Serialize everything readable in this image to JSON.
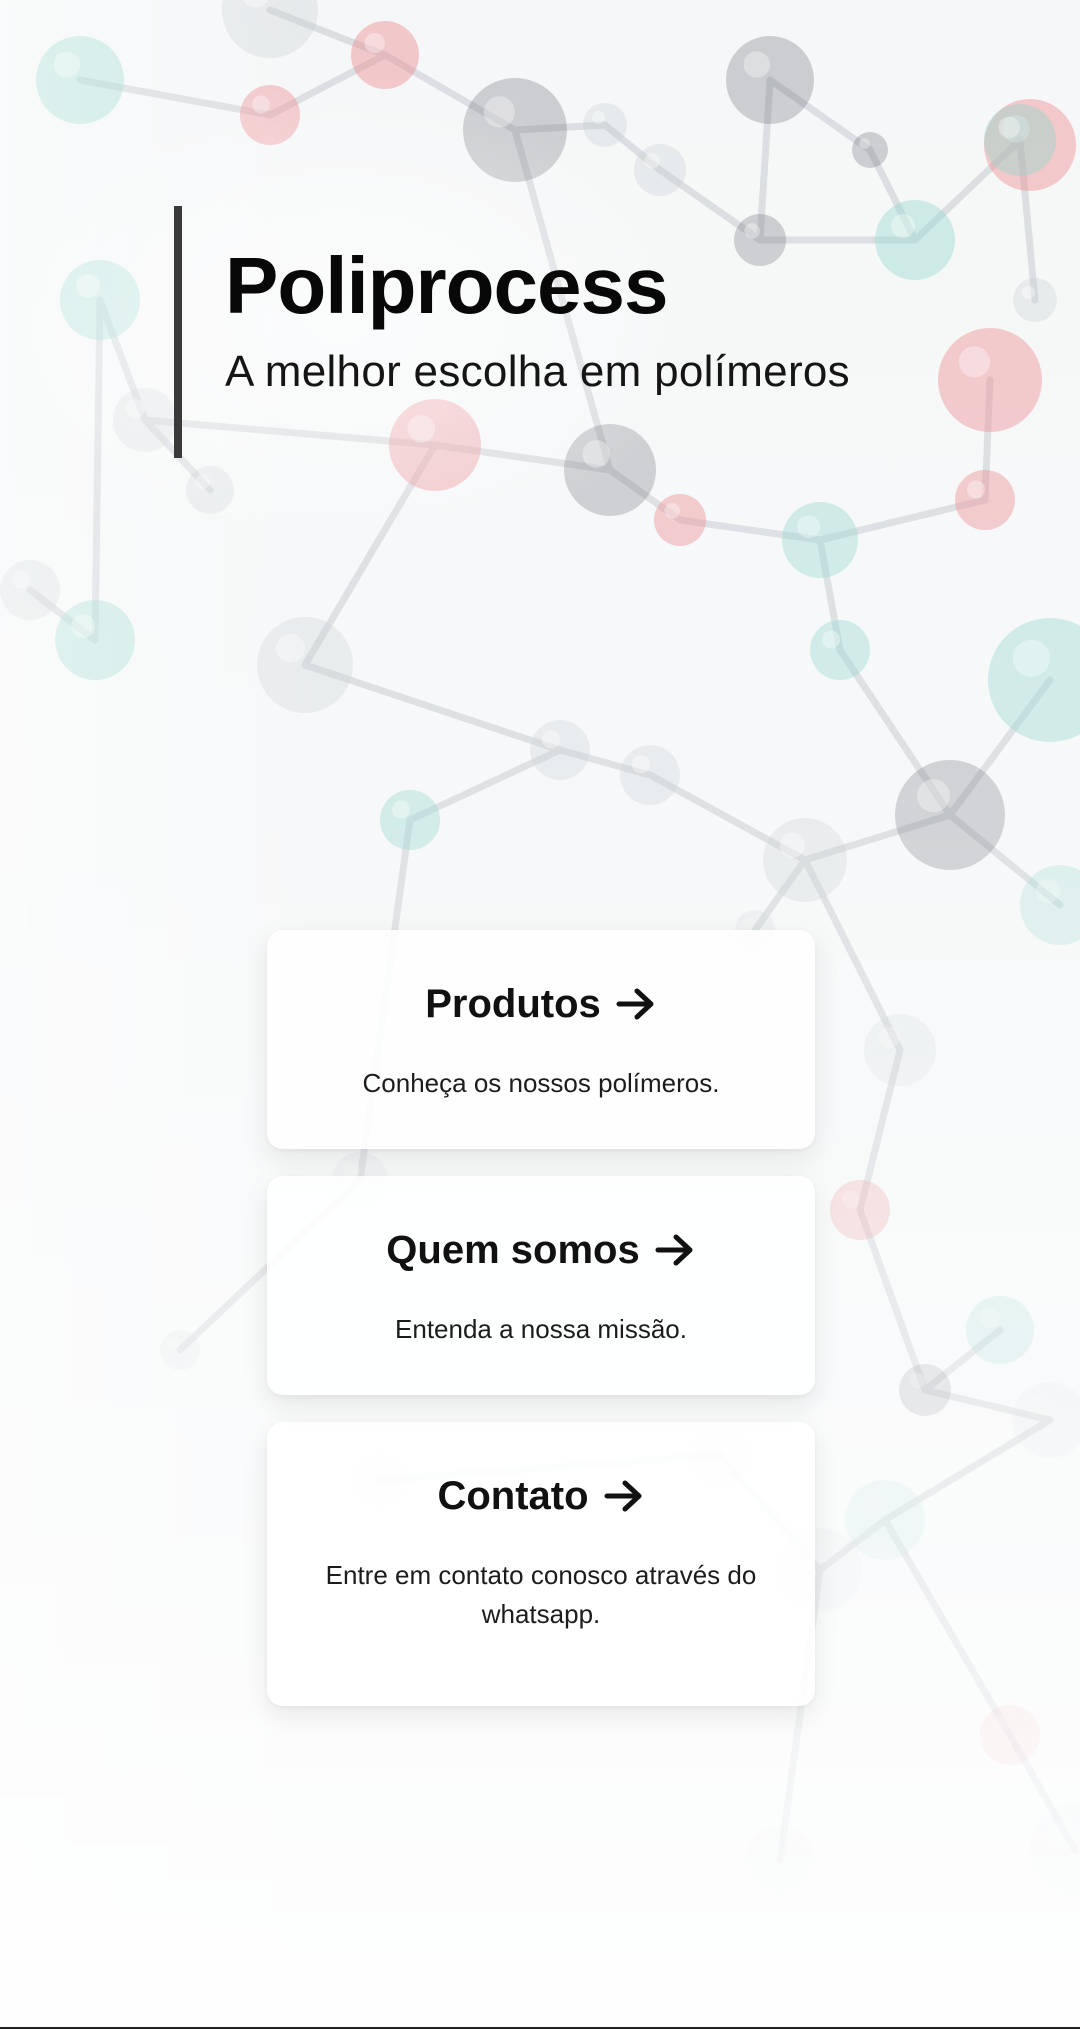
{
  "brand": {
    "title": "Poliprocess",
    "subtitle": "A melhor escolha em polímeros"
  },
  "cards": [
    {
      "title": "Produtos",
      "description": "Conheça os nossos polímeros.",
      "icon": "arrow-right-icon"
    },
    {
      "title": "Quem somos",
      "description": "Entenda a nossa missão.",
      "icon": "arrow-right-icon"
    },
    {
      "title": "Contato",
      "description": "Entre em contato conosco através do whatsapp.",
      "icon": "arrow-right-icon"
    }
  ],
  "colors": {
    "accent_bar": "#3a3a3a",
    "text": "#0d0d0d",
    "card_bg": "#ffffff",
    "atom_red": "#e8787c",
    "atom_teal": "#7fcfc4",
    "atom_dark": "#3f4650"
  },
  "background": {
    "icon": "molecule-pattern"
  }
}
